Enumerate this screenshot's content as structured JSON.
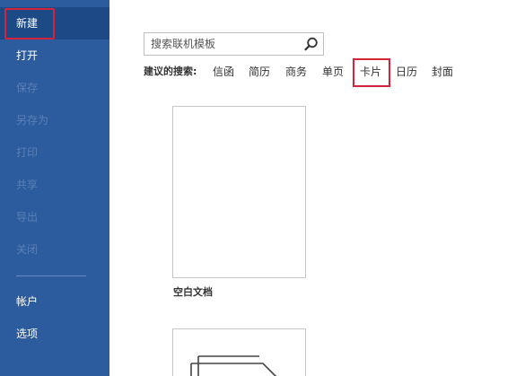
{
  "sidebar": {
    "items": [
      {
        "label": "新建",
        "state": "active"
      },
      {
        "label": "打开",
        "state": "enabled"
      },
      {
        "label": "保存",
        "state": "disabled"
      },
      {
        "label": "另存为",
        "state": "disabled"
      },
      {
        "label": "打印",
        "state": "disabled"
      },
      {
        "label": "共享",
        "state": "disabled"
      },
      {
        "label": "导出",
        "state": "disabled"
      },
      {
        "label": "关闭",
        "state": "disabled"
      },
      {
        "label": "帐户",
        "state": "enabled"
      },
      {
        "label": "选项",
        "state": "enabled"
      }
    ]
  },
  "search": {
    "placeholder": "搜索联机模板",
    "value": ""
  },
  "suggested": {
    "label": "建议的搜索:",
    "links": [
      "信函",
      "简历",
      "商务",
      "单页",
      "卡片",
      "日历",
      "封面"
    ],
    "highlighted": "卡片"
  },
  "templates": [
    {
      "caption": "空白文档"
    },
    {
      "caption": ""
    }
  ],
  "colors": {
    "sidebar_bg": "#2c5c9e",
    "active_bg": "#1d4a86",
    "highlight": "#d3243a"
  }
}
